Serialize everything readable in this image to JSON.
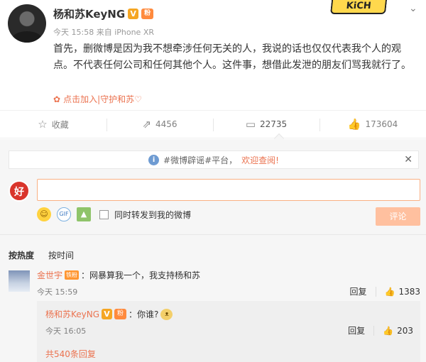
{
  "post": {
    "author": "杨和苏KeyNG",
    "v_badge": "V",
    "fan_badge": "粉",
    "meta": "今天 15:58 来自 iPhone XR",
    "sticker": "KiCH",
    "content": "首先，删微博是因为我不想牵涉任何无关的人，我说的话也仅仅代表我个人的观点。不代表任何公司和任何其他个人。这件事，想借此发泄的朋友们骂我就行了。",
    "supertopic": "点击加入|守护和苏♡"
  },
  "actions": {
    "favorite": "收藏",
    "repost": "4456",
    "comment": "22735",
    "like": "173604"
  },
  "comment_box": {
    "notice_prefix": "#微博辟谣#平台，",
    "notice_highlight": "欢迎查阅!",
    "my_avatar": "好",
    "input_value": "",
    "forward_label": "同时转发到我的微博",
    "submit_label": "评论"
  },
  "sort": {
    "hot": "按热度",
    "time": "按时间"
  },
  "comment": {
    "user": "金世宇",
    "badge": "铁粉",
    "text": "：网暴算我一个，我支持杨和苏",
    "time": "今天 15:59",
    "reply_label": "回复",
    "likes": "1383"
  },
  "reply": {
    "user": "杨和苏KeyNG",
    "v_badge": "V",
    "fan_badge": "粉",
    "text": "：你谁?",
    "time": "今天 16:05",
    "reply_label": "回复",
    "likes": "203",
    "more": "共540条回复"
  }
}
